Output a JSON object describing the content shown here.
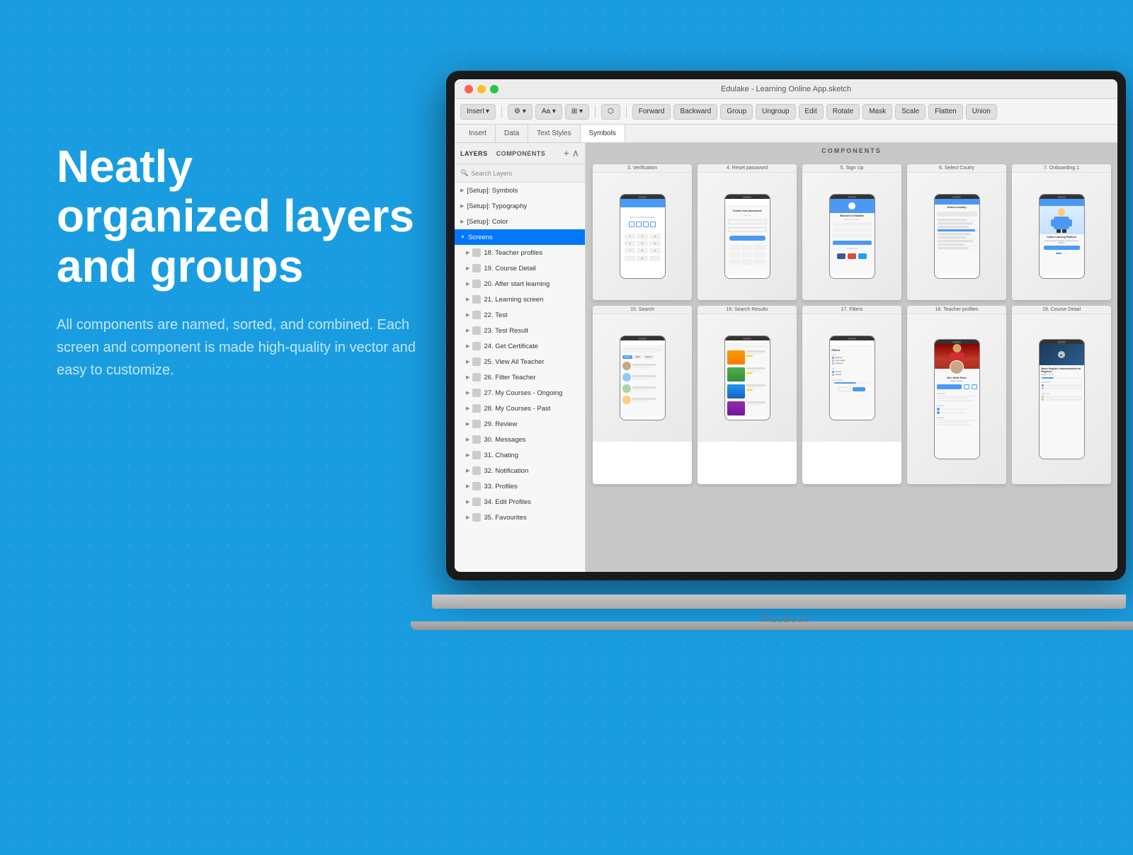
{
  "background_color": "#1a9de0",
  "left_content": {
    "headline_line1": "Neatly",
    "headline_line2": "organized layers",
    "headline_line3": "and groups",
    "subtext": "All components are named, sorted, and combined. Each screen and component is made high-quality in vector and easy to customize."
  },
  "macbook": {
    "label": "MacBook",
    "title_bar": "Edulake - Learning Online App.sketch"
  },
  "toolbar": {
    "tabs": [
      "Insert",
      "Data",
      "Text Styles",
      "Symbols",
      "Create Symbol",
      "Forward",
      "Backward",
      "Group",
      "Ungroup",
      "Edit",
      "Rotate",
      "Mask",
      "Scale",
      "Flatten",
      "Union"
    ]
  },
  "layers_panel": {
    "header_tabs": [
      "LAYERS",
      "COMPONENTS"
    ],
    "items": [
      "[Setup]: Symbols",
      "[Setup]: Typography",
      "[Setup]: Color",
      "Screens",
      "18. Teacher profiles",
      "19. Course Detail",
      "20. After start learning",
      "21. Learning screen",
      "22. Test",
      "23. Test Result",
      "24. Get Certificate",
      "25. View All Teacher",
      "26. Filter Teacher",
      "27. My Courses - Ongoing",
      "28. My Courses - Past",
      "29. Review",
      "30. Messages",
      "31. Chating",
      "32. Notification",
      "33. Profiles",
      "34. Edit Profiles",
      "35. Favourites"
    ],
    "search_placeholder": "Search Layers"
  },
  "canvas": {
    "components_label": "COMPONENTS",
    "screens": [
      {
        "number": "3.",
        "label": "Verification"
      },
      {
        "number": "4.",
        "label": "Reset password"
      },
      {
        "number": "5.",
        "label": "Sign Up"
      },
      {
        "number": "6.",
        "label": "Select Coutry"
      },
      {
        "number": "7.",
        "label": "Onboarding 1"
      },
      {
        "number": "15.",
        "label": "Search"
      },
      {
        "number": "16.",
        "label": "Search Results"
      },
      {
        "number": "17.",
        "label": "Filters"
      },
      {
        "number": "18.",
        "label": "Teacher profiles"
      },
      {
        "number": "19.",
        "label": "Course Detail"
      }
    ]
  }
}
